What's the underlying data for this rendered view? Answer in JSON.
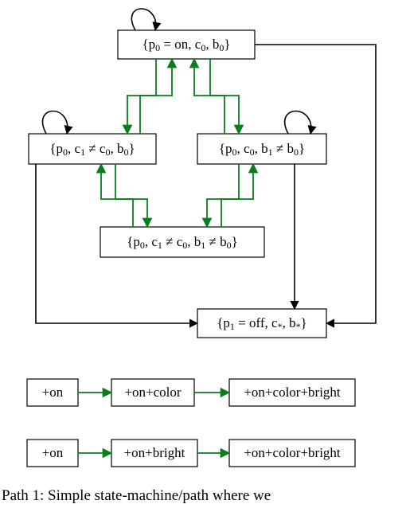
{
  "nodes": {
    "top": {
      "label_html": "{p<sub>0</sub> = on, c<sub>0</sub>, b<sub>0</sub>}"
    },
    "left": {
      "label_html": "{p<sub>0</sub>, c<sub>1</sub> ≠ c<sub>0</sub>, b<sub>0</sub>}"
    },
    "right": {
      "label_html": "{p<sub>0</sub>, c<sub>0</sub>, b<sub>1</sub> ≠ b<sub>0</sub>}"
    },
    "mid": {
      "label_html": "{p<sub>0</sub>, c<sub>1</sub> ≠ c<sub>0</sub>, b<sub>1</sub> ≠ b<sub>0</sub>}"
    },
    "off": {
      "label_html": "{p<sub>1</sub> = off, c<sub>*</sub>, b<sub>*</sub>}"
    }
  },
  "paths": {
    "row1": {
      "a": "+on",
      "b": "+on+color",
      "c": "+on+color+bright"
    },
    "row2": {
      "a": "+on",
      "b": "+on+bright",
      "c": "+on+color+bright"
    }
  },
  "caption": "Path 1: Simple state-machine/path where we",
  "colors": {
    "edge_green": "#0a7d1d",
    "edge_black": "#000000"
  },
  "chart_data": {
    "type": "diagram",
    "state_machine": {
      "states": [
        {
          "id": "top",
          "label": "{p0 = on, c0, b0}"
        },
        {
          "id": "left",
          "label": "{p0, c1 ≠ c0, b0}"
        },
        {
          "id": "right",
          "label": "{p0, c0, b1 ≠ b0}"
        },
        {
          "id": "mid",
          "label": "{p0, c1 ≠ c0, b1 ≠ b0}"
        },
        {
          "id": "off",
          "label": "{p1 = off, c*, b*}"
        }
      ],
      "self_loops": [
        "top",
        "left",
        "right"
      ],
      "edges": [
        {
          "from": "top",
          "to": "left",
          "color": "green"
        },
        {
          "from": "top",
          "to": "right",
          "color": "green"
        },
        {
          "from": "left",
          "to": "top",
          "color": "green"
        },
        {
          "from": "right",
          "to": "top",
          "color": "green"
        },
        {
          "from": "left",
          "to": "mid",
          "color": "green"
        },
        {
          "from": "right",
          "to": "mid",
          "color": "green"
        },
        {
          "from": "mid",
          "to": "left",
          "color": "green"
        },
        {
          "from": "mid",
          "to": "right",
          "color": "green"
        },
        {
          "from": "top",
          "to": "off",
          "color": "black"
        },
        {
          "from": "left",
          "to": "off",
          "color": "black"
        },
        {
          "from": "right",
          "to": "off",
          "color": "black"
        },
        {
          "from": "off",
          "to": "top",
          "color": "black"
        }
      ]
    },
    "sequences": [
      [
        "+on",
        "+on+color",
        "+on+color+bright"
      ],
      [
        "+on",
        "+on+bright",
        "+on+color+bright"
      ]
    ],
    "caption": "Path 1: Simple state-machine/path where we"
  }
}
